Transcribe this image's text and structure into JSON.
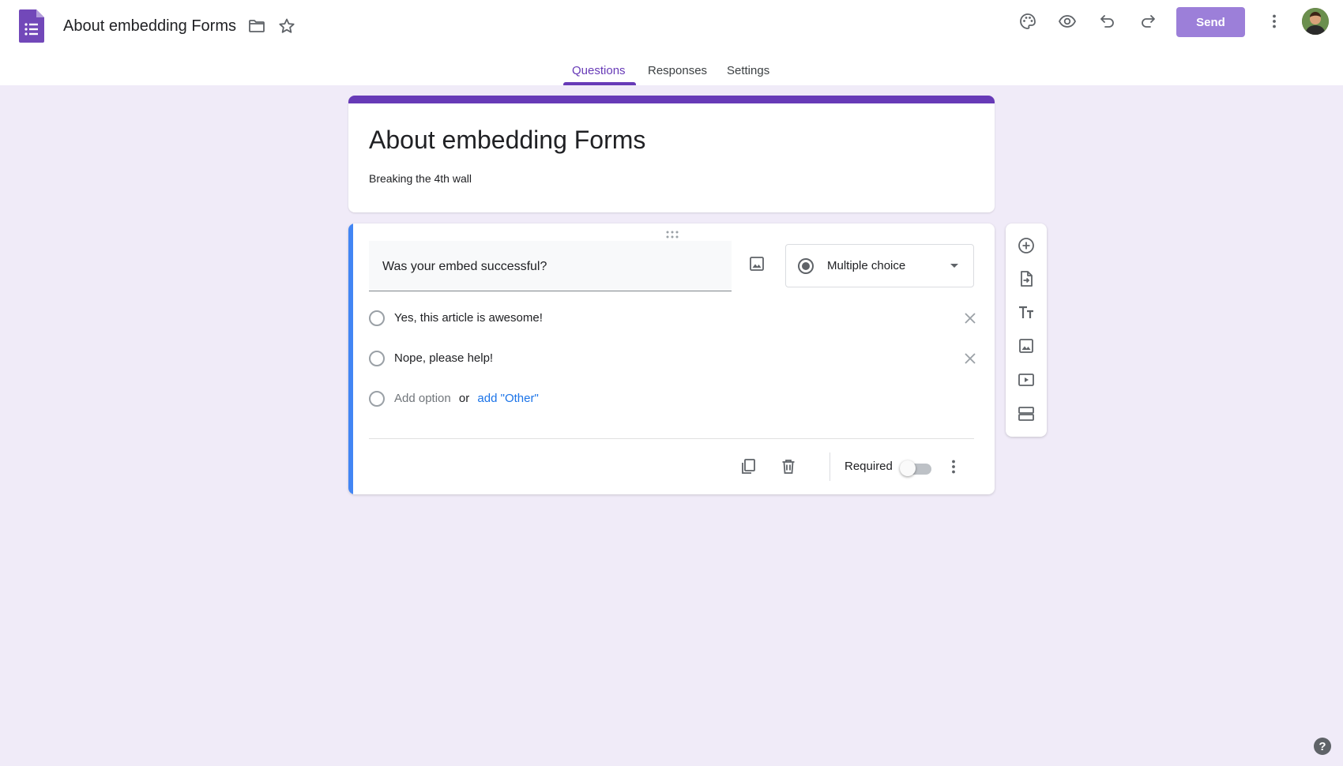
{
  "header": {
    "doc_title": "About embedding Forms",
    "send_label": "Send"
  },
  "tabs": [
    {
      "label": "Questions",
      "active": true
    },
    {
      "label": "Responses",
      "active": false
    },
    {
      "label": "Settings",
      "active": false
    }
  ],
  "form": {
    "title": "About embedding Forms",
    "description": "Breaking the 4th wall"
  },
  "question": {
    "text": "Was your embed successful?",
    "type": "Multiple choice",
    "options": [
      {
        "label": "Yes, this article is awesome!"
      },
      {
        "label": "Nope, please help!"
      }
    ],
    "add_option": "Add option",
    "or_text": "or",
    "add_other": "add \"Other\"",
    "required_label": "Required",
    "required": false
  },
  "help_label": "?",
  "colors": {
    "brand": "#673ab7",
    "background": "#f0ebf8",
    "send_button": "#9c7fd9",
    "question_accent": "#4285f4",
    "link": "#1a73e8"
  },
  "icons": {
    "header": [
      "forms-logo-icon",
      "folder-icon",
      "star-icon",
      "palette-icon",
      "eye-icon",
      "undo-icon",
      "redo-icon",
      "more-vert-icon"
    ],
    "toolbar": [
      "add-question-icon",
      "import-questions-icon",
      "title-text-icon",
      "image-icon",
      "video-icon",
      "section-icon"
    ],
    "footer": [
      "duplicate-icon",
      "delete-icon",
      "more-vert-icon"
    ]
  }
}
